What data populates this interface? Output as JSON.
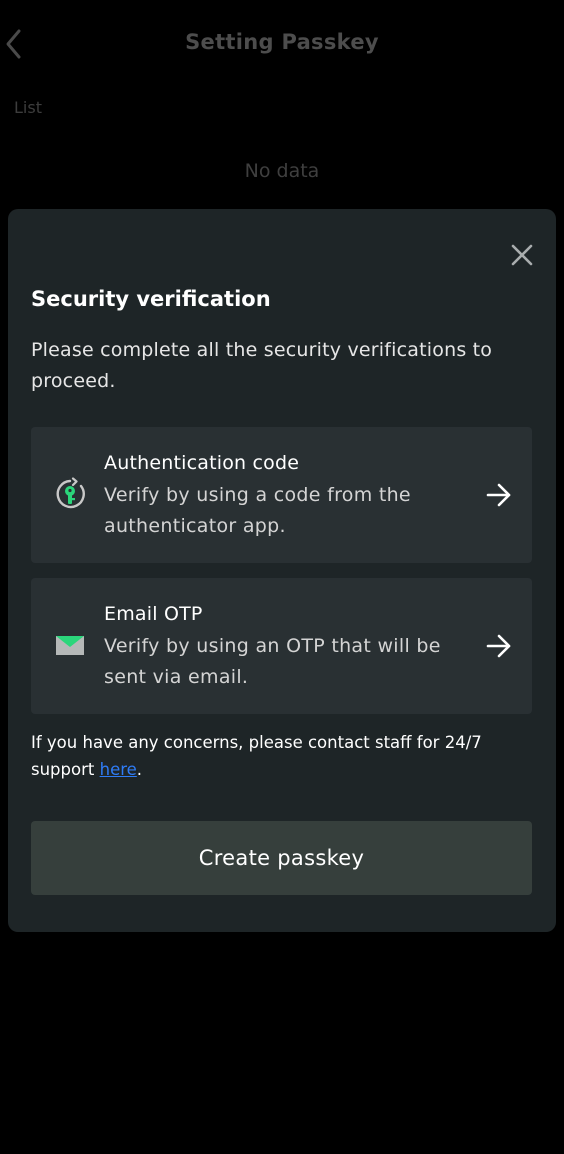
{
  "header": {
    "title": "Setting Passkey",
    "back_icon": "chevron-left-icon"
  },
  "list": {
    "label": "List",
    "empty_text": "No data"
  },
  "modal": {
    "title": "Security verification",
    "description": "Please complete all the security verifications to proceed.",
    "close_icon": "close-icon",
    "options": [
      {
        "title": "Authentication code",
        "description": "Verify by using a code from the authenticator app.",
        "icon": "authenticator-key-icon",
        "arrow_icon": "arrow-right-icon"
      },
      {
        "title": "Email OTP",
        "description": "Verify by using an OTP that will be sent via email.",
        "icon": "envelope-icon",
        "arrow_icon": "arrow-right-icon"
      }
    ],
    "support": {
      "text": "If you have any concerns, please contact staff for 24/7 support ",
      "link_text": "here",
      "suffix": "."
    },
    "create_button": "Create passkey"
  },
  "colors": {
    "background": "#000000",
    "modal_bg": "#1e2527",
    "card_bg": "#293033",
    "accent_green": "#2bd67b",
    "link_blue": "#2f7cf6",
    "button_bg": "#363f3c"
  }
}
